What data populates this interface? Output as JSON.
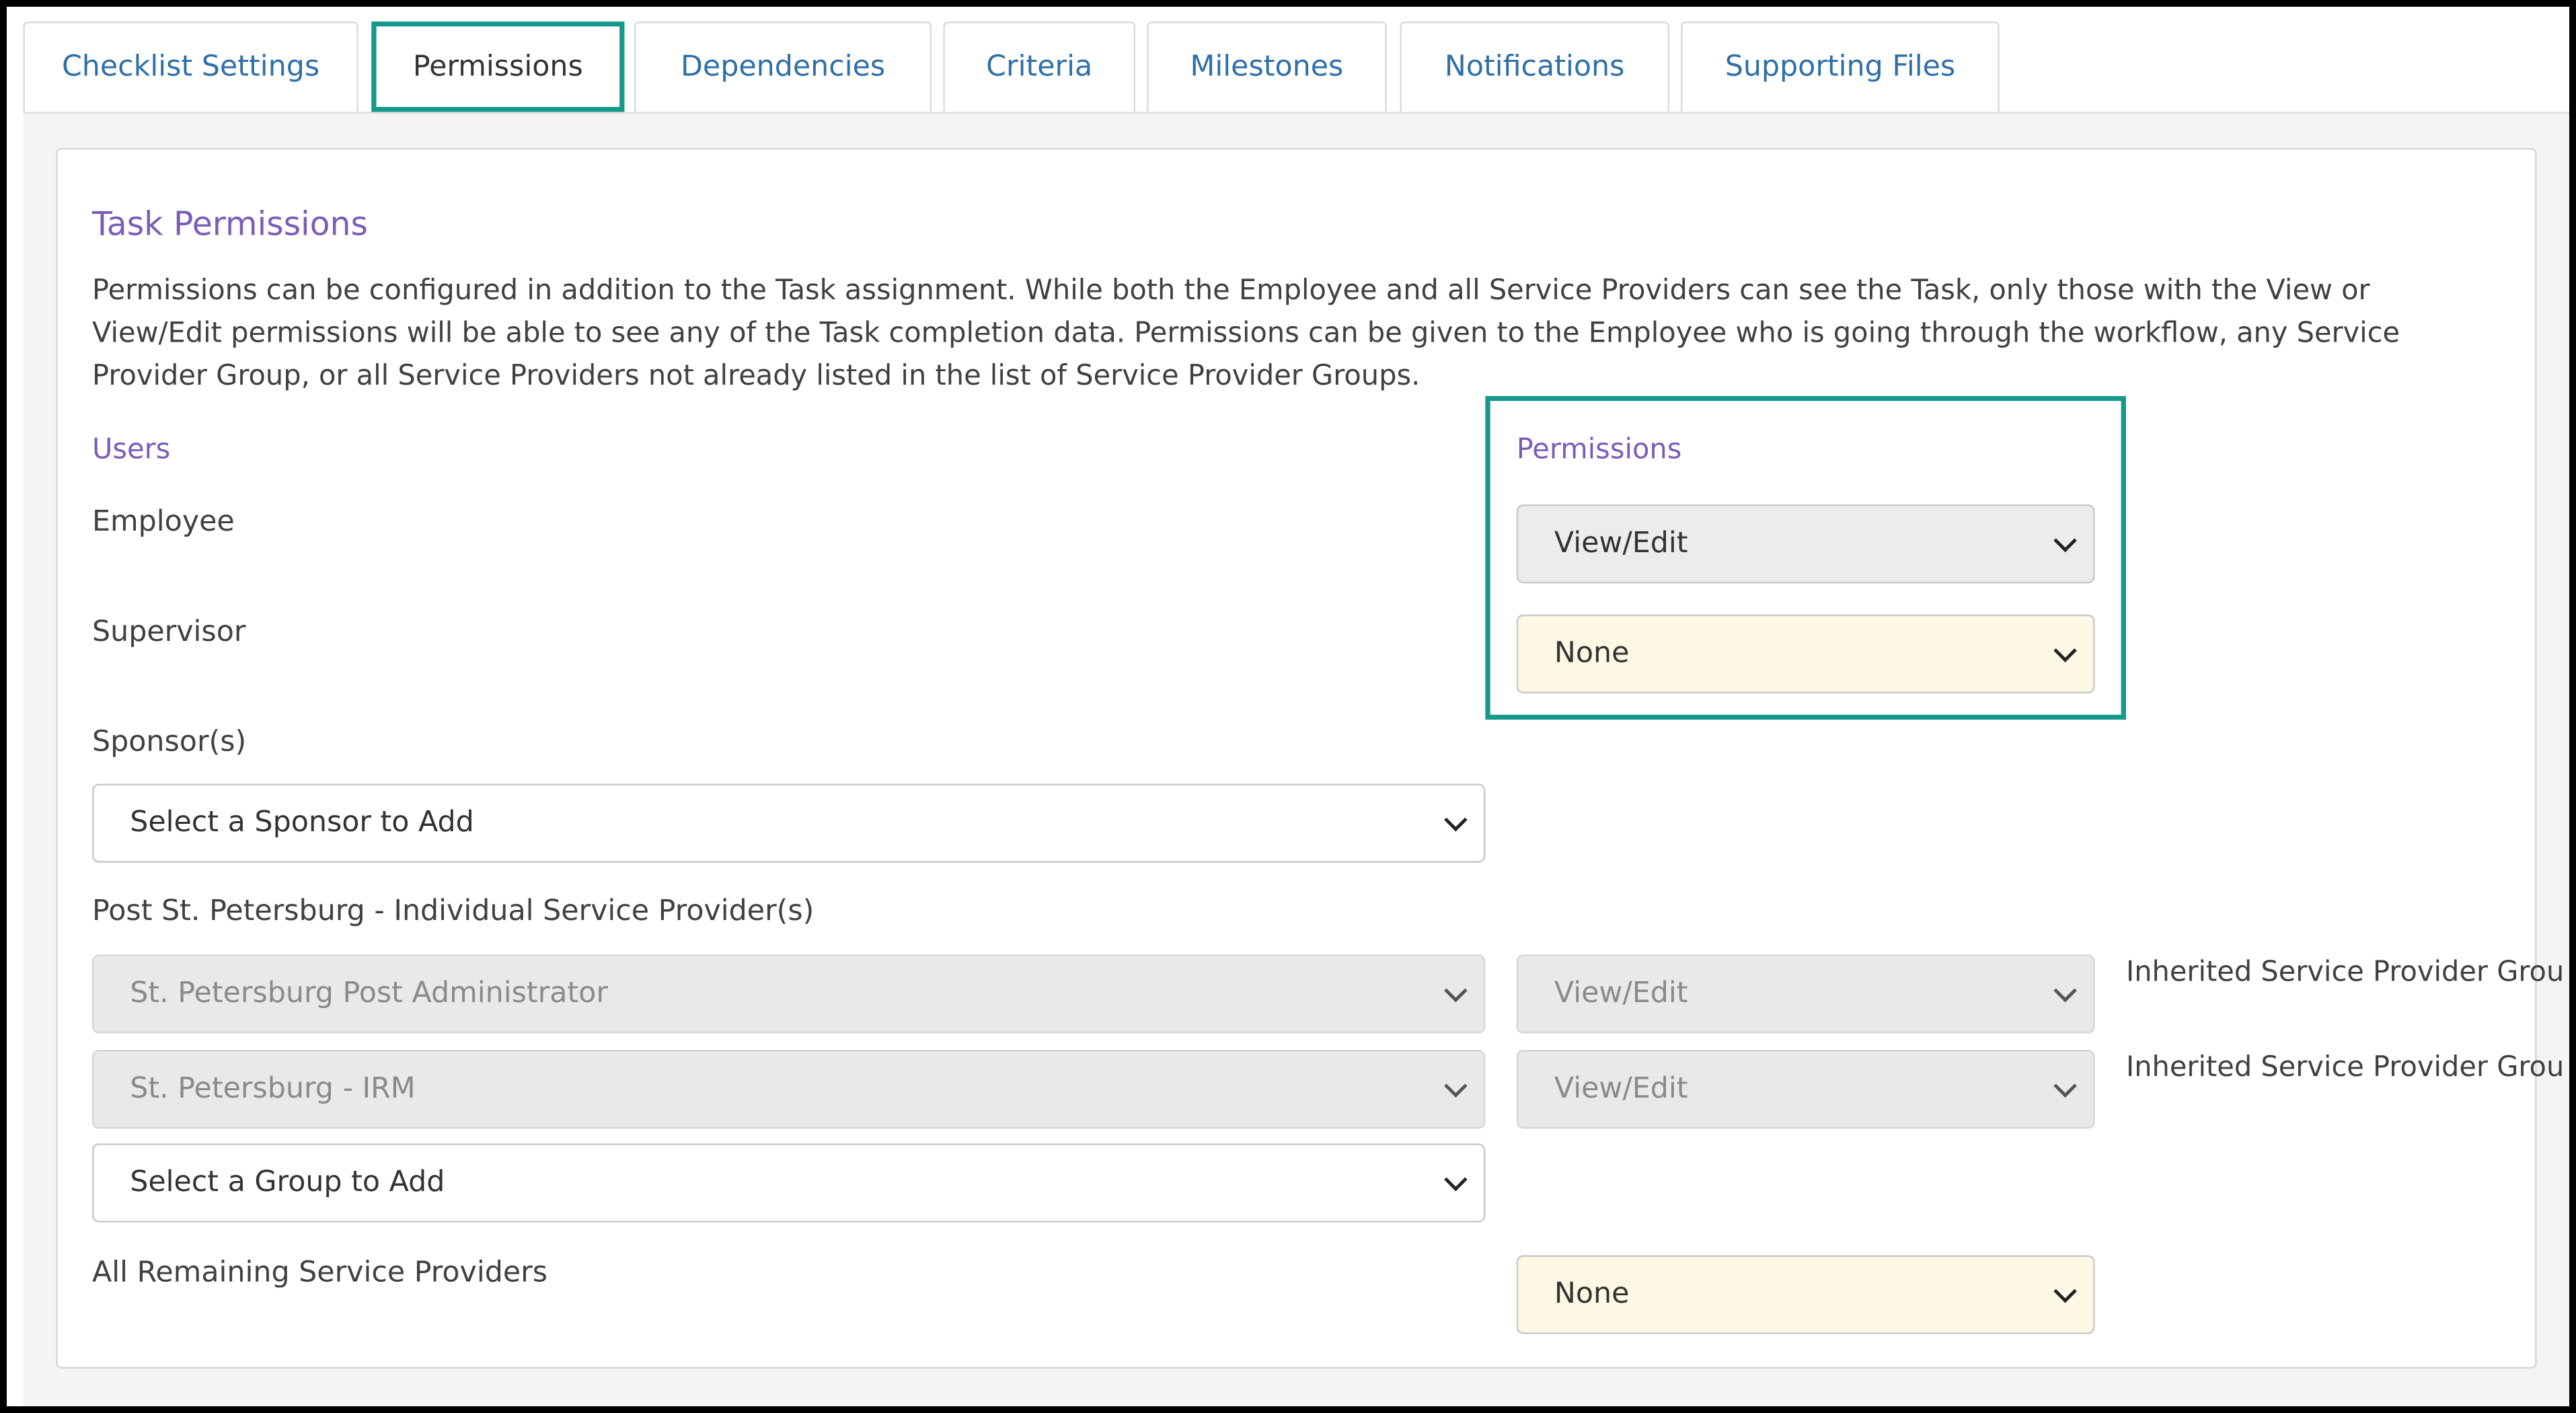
{
  "tabs": [
    {
      "label": "Checklist Settings",
      "active": false
    },
    {
      "label": "Permissions",
      "active": true
    },
    {
      "label": "Dependencies",
      "active": false
    },
    {
      "label": "Criteria",
      "active": false
    },
    {
      "label": "Milestones",
      "active": false
    },
    {
      "label": "Notifications",
      "active": false
    },
    {
      "label": "Supporting Files",
      "active": false
    }
  ],
  "section": {
    "title": "Task Permissions",
    "description": "Permissions can be configured in addition to the Task assignment. While both the Employee and all Service Providers can see the Task, only those with the View or View/Edit permissions will be able to see any of the Task completion data. Permissions can be given to the Employee who is going through the workflow, any Service Provider Group, or all Service Providers not already listed in the list of Service Provider Groups."
  },
  "columns": {
    "users": "Users",
    "permissions": "Permissions"
  },
  "rows": {
    "employee": {
      "label": "Employee",
      "permission": "View/Edit"
    },
    "supervisor": {
      "label": "Supervisor",
      "permission": "None"
    }
  },
  "sponsors": {
    "label": "Sponsor(s)",
    "select_placeholder": "Select a Sponsor to Add"
  },
  "providers": {
    "label": "Post St. Petersburg - Individual Service Provider(s)",
    "items": [
      {
        "name": "St. Petersburg Post Administrator",
        "permission": "View/Edit",
        "note": "Inherited Service Provider Grou"
      },
      {
        "name": "St. Petersburg - IRM",
        "permission": "View/Edit",
        "note": "Inherited Service Provider Grou"
      }
    ],
    "group_placeholder": "Select a Group to Add"
  },
  "remaining": {
    "label": "All Remaining Service Providers",
    "permission": "None"
  },
  "colors": {
    "accent": "#14998a",
    "heading": "#7b5cb8",
    "link": "#2f6fa8",
    "warning_bg": "#fdf8e4"
  },
  "icons": {
    "dropdown": "chevron-down-icon"
  }
}
